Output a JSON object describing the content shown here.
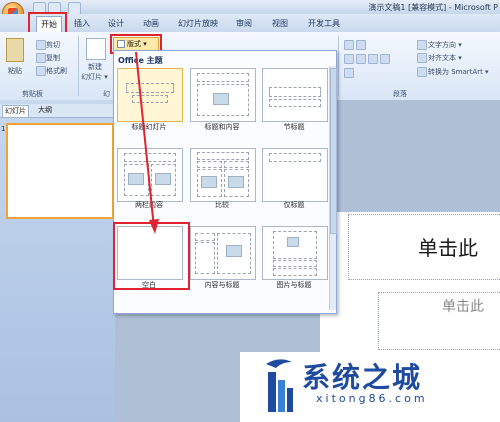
{
  "window": {
    "title": "演示文稿1 [兼容模式] - Microsoft P"
  },
  "ribbon": {
    "tabs": [
      "开始",
      "插入",
      "设计",
      "动画",
      "幻灯片放映",
      "审阅",
      "视图",
      "开发工具"
    ],
    "clipboard": {
      "paste": "粘贴",
      "cut": "剪切",
      "copy": "复制",
      "format_painter": "格式刷",
      "group_label": "剪贴板"
    },
    "slides": {
      "new_slide_line1": "新建",
      "new_slide_line2": "幻灯片 ▾",
      "layout_button": "版式 ▾",
      "group_label": "幻"
    },
    "paragraph": {
      "text_direction": "文字方向 ▾",
      "align_text": "对齐文本 ▾",
      "smartart": "转换为 SmartArt ▾",
      "group_label": "段落"
    }
  },
  "left_panel": {
    "tab_slides": "幻灯片",
    "tab_outline": "大纲",
    "slide_number": "1"
  },
  "layout_gallery": {
    "heading": "Office 主题",
    "layouts": [
      {
        "label": "标题幻灯片",
        "selected": true
      },
      {
        "label": "标题和内容",
        "selected": false
      },
      {
        "label": "节标题",
        "selected": false
      },
      {
        "label": "两栏内容",
        "selected": false
      },
      {
        "label": "比较",
        "selected": false
      },
      {
        "label": "仅标题",
        "selected": false
      },
      {
        "label": "空白",
        "selected": false
      },
      {
        "label": "内容与标题",
        "selected": false
      },
      {
        "label": "图片与标题",
        "selected": false
      }
    ]
  },
  "slide": {
    "title_placeholder": "单击此",
    "subtitle_placeholder": "单击此"
  },
  "watermark": {
    "name": "系统之城",
    "url": "xitong86.com"
  },
  "colors": {
    "highlight": "#e0232e",
    "accent": "#1e4aa0",
    "selected_fill": "#fff6d6"
  }
}
